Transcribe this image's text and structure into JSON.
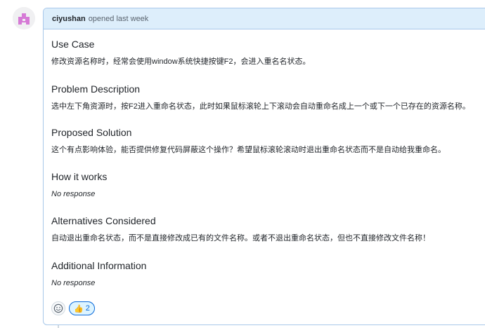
{
  "comment": {
    "author": "ciyushan",
    "action": "opened last week"
  },
  "sections": [
    {
      "heading": "Use Case",
      "text": "修改资源名称时，经常会使用window系统快捷按键F2，会进入重名名状态。",
      "italic": false
    },
    {
      "heading": "Problem Description",
      "text": "选中左下角资源时，按F2进入重命名状态，此时如果鼠标滚轮上下滚动会自动重命名成上一个或下一个已存在的资源名称。",
      "italic": false
    },
    {
      "heading": "Proposed Solution",
      "text": "这个有点影响体验，能否提供修复代码屏蔽这个操作？希望鼠标滚轮滚动时退出重命名状态而不是自动给我重命名。",
      "italic": false
    },
    {
      "heading": "How it works",
      "text": "No response",
      "italic": true
    },
    {
      "heading": "Alternatives Considered",
      "text": "自动退出重命名状态，而不是直接修改成已有的文件名称。或者不退出重命名状态，但也不直接修改文件名称！",
      "italic": false
    },
    {
      "heading": "Additional Information",
      "text": "No response",
      "italic": true
    }
  ],
  "reactions": {
    "add_icon": "smiley-icon",
    "thumbs_up": {
      "emoji": "👍",
      "count": "2"
    }
  },
  "colors": {
    "header_bg": "#ddeefb",
    "border": "#a8c8ea",
    "accent": "#0969da",
    "avatar": "#d67ad6"
  }
}
